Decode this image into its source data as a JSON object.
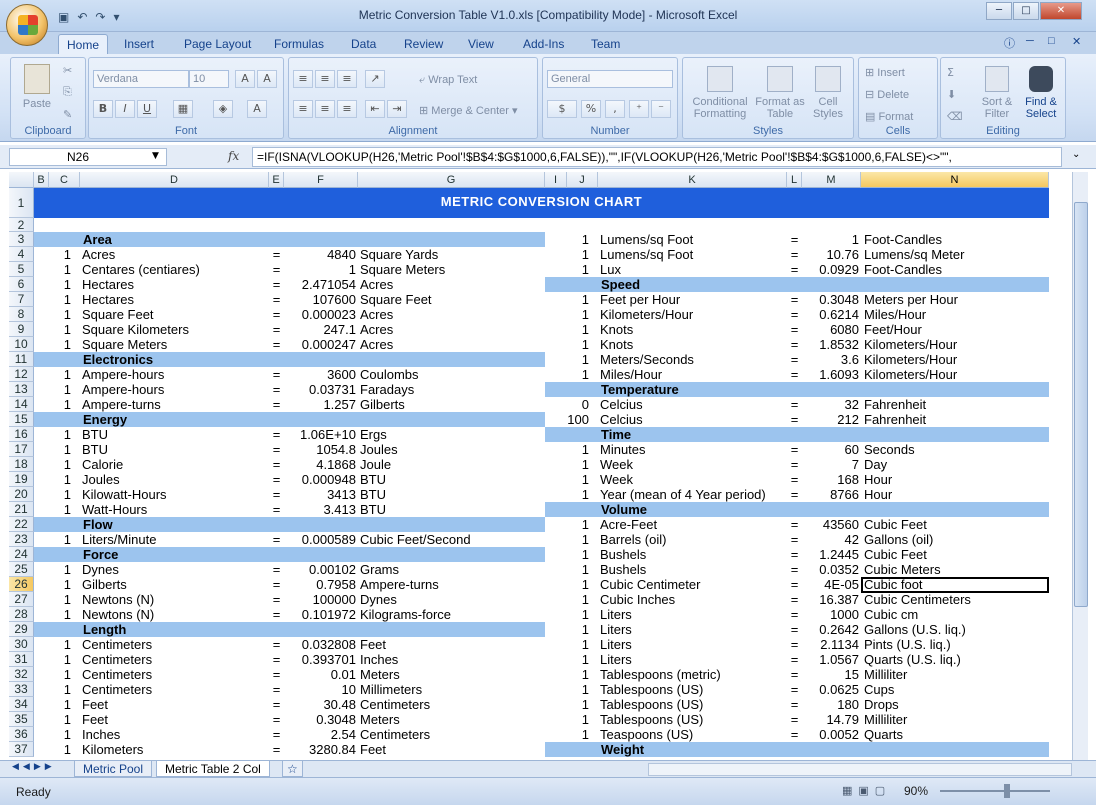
{
  "window": {
    "title": "Metric Conversion Table V1.0.xls  [Compatibility Mode] - Microsoft Excel"
  },
  "tabs": [
    "Home",
    "Insert",
    "Page Layout",
    "Formulas",
    "Data",
    "Review",
    "View",
    "Add-Ins",
    "Team"
  ],
  "ribbon": {
    "clipboard": {
      "paste": "Paste",
      "label": "Clipboard"
    },
    "font": {
      "name": "Verdana",
      "size": "10",
      "label": "Font",
      "bold": "B",
      "italic": "I",
      "underline": "U"
    },
    "alignment": {
      "wrap": "Wrap Text",
      "merge": "Merge & Center",
      "label": "Alignment"
    },
    "number": {
      "format": "General",
      "label": "Number",
      "currency": "$",
      "percent": "%",
      "comma": ","
    },
    "styles": {
      "conditional": "Conditional Formatting",
      "format_table": "Format as Table",
      "cell_styles": "Cell Styles",
      "label": "Styles"
    },
    "cells": {
      "insert": "Insert",
      "delete": "Delete",
      "format": "Format",
      "label": "Cells"
    },
    "editing": {
      "sort": "Sort & Filter",
      "find": "Find & Select",
      "label": "Editing"
    }
  },
  "formula_bar": {
    "name_box": "N26",
    "fx": "fx",
    "formula": "=IF(ISNA(VLOOKUP(H26,'Metric Pool'!$B$4:$G$1000,6,FALSE)),\"\",IF(VLOOKUP(H26,'Metric Pool'!$B$4:$G$1000,6,FALSE)<>\"\","
  },
  "columns_left": [
    "B",
    "C",
    "D",
    "E",
    "F",
    "G"
  ],
  "columns_right": [
    "I",
    "J",
    "K",
    "L",
    "M",
    "N"
  ],
  "rows": [
    "1",
    "2",
    "3",
    "4",
    "5",
    "6",
    "7",
    "8",
    "9",
    "10",
    "11",
    "12",
    "13",
    "14",
    "15",
    "16",
    "17",
    "18",
    "19",
    "20",
    "21",
    "22",
    "23",
    "24",
    "25",
    "26",
    "27",
    "28",
    "29",
    "30",
    "31",
    "32",
    "33",
    "34",
    "35",
    "36",
    "37"
  ],
  "sheet_title": "METRIC CONVERSION CHART",
  "left": [
    {
      "cat": "Area"
    },
    {
      "q": "1",
      "u": "Acres",
      "eq": "=",
      "v": "4840",
      "t": "Square Yards"
    },
    {
      "q": "1",
      "u": "Centares (centiares)",
      "eq": "=",
      "v": "1",
      "t": "Square Meters"
    },
    {
      "q": "1",
      "u": "Hectares",
      "eq": "=",
      "v": "2.471054",
      "t": "Acres"
    },
    {
      "q": "1",
      "u": "Hectares",
      "eq": "=",
      "v": "107600",
      "t": "Square Feet"
    },
    {
      "q": "1",
      "u": "Square Feet",
      "eq": "=",
      "v": "0.000023",
      "t": "Acres"
    },
    {
      "q": "1",
      "u": "Square Kilometers",
      "eq": "=",
      "v": "247.1",
      "t": "Acres"
    },
    {
      "q": "1",
      "u": "Square Meters",
      "eq": "=",
      "v": "0.000247",
      "t": "Acres"
    },
    {
      "cat": "Electronics"
    },
    {
      "q": "1",
      "u": "Ampere-hours",
      "eq": "=",
      "v": "3600",
      "t": "Coulombs"
    },
    {
      "q": "1",
      "u": "Ampere-hours",
      "eq": "=",
      "v": "0.03731",
      "t": "Faradays"
    },
    {
      "q": "1",
      "u": "Ampere-turns",
      "eq": "=",
      "v": "1.257",
      "t": "Gilberts"
    },
    {
      "cat": "Energy"
    },
    {
      "q": "1",
      "u": "BTU",
      "eq": "=",
      "v": "1.06E+10",
      "t": "Ergs"
    },
    {
      "q": "1",
      "u": "BTU",
      "eq": "=",
      "v": "1054.8",
      "t": "Joules"
    },
    {
      "q": "1",
      "u": "Calorie",
      "eq": "=",
      "v": "4.1868",
      "t": "Joule"
    },
    {
      "q": "1",
      "u": "Joules",
      "eq": "=",
      "v": "0.000948",
      "t": "BTU"
    },
    {
      "q": "1",
      "u": "Kilowatt-Hours",
      "eq": "=",
      "v": "3413",
      "t": "BTU"
    },
    {
      "q": "1",
      "u": "Watt-Hours",
      "eq": "=",
      "v": "3.413",
      "t": "BTU"
    },
    {
      "cat": "Flow"
    },
    {
      "q": "1",
      "u": "Liters/Minute",
      "eq": "=",
      "v": "0.000589",
      "t": "Cubic Feet/Second"
    },
    {
      "cat": "Force"
    },
    {
      "q": "1",
      "u": "Dynes",
      "eq": "=",
      "v": "0.00102",
      "t": "Grams"
    },
    {
      "q": "1",
      "u": "Gilberts",
      "eq": "=",
      "v": "0.7958",
      "t": "Ampere-turns"
    },
    {
      "q": "1",
      "u": "Newtons (N)",
      "eq": "=",
      "v": "100000",
      "t": "Dynes"
    },
    {
      "q": "1",
      "u": "Newtons (N)",
      "eq": "=",
      "v": "0.101972",
      "t": "Kilograms-force"
    },
    {
      "cat": "Length"
    },
    {
      "q": "1",
      "u": "Centimeters",
      "eq": "=",
      "v": "0.032808",
      "t": "Feet"
    },
    {
      "q": "1",
      "u": "Centimeters",
      "eq": "=",
      "v": "0.393701",
      "t": "Inches"
    },
    {
      "q": "1",
      "u": "Centimeters",
      "eq": "=",
      "v": "0.01",
      "t": "Meters"
    },
    {
      "q": "1",
      "u": "Centimeters",
      "eq": "=",
      "v": "10",
      "t": "Millimeters"
    },
    {
      "q": "1",
      "u": "Feet",
      "eq": "=",
      "v": "30.48",
      "t": "Centimeters"
    },
    {
      "q": "1",
      "u": "Feet",
      "eq": "=",
      "v": "0.3048",
      "t": "Meters"
    },
    {
      "q": "1",
      "u": "Inches",
      "eq": "=",
      "v": "2.54",
      "t": "Centimeters"
    },
    {
      "q": "1",
      "u": "Kilometers",
      "eq": "=",
      "v": "3280.84",
      "t": "Feet"
    }
  ],
  "right": [
    {
      "q": "1",
      "u": "Lumens/sq Foot",
      "eq": "=",
      "v": "1",
      "t": "Foot-Candles"
    },
    {
      "q": "1",
      "u": "Lumens/sq Foot",
      "eq": "=",
      "v": "10.76",
      "t": "Lumens/sq Meter"
    },
    {
      "q": "1",
      "u": "Lux",
      "eq": "=",
      "v": "0.0929",
      "t": "Foot-Candles"
    },
    {
      "cat": "Speed"
    },
    {
      "q": "1",
      "u": "Feet per Hour",
      "eq": "=",
      "v": "0.3048",
      "t": "Meters per Hour"
    },
    {
      "q": "1",
      "u": "Kilometers/Hour",
      "eq": "=",
      "v": "0.6214",
      "t": "Miles/Hour"
    },
    {
      "q": "1",
      "u": "Knots",
      "eq": "=",
      "v": "6080",
      "t": "Feet/Hour"
    },
    {
      "q": "1",
      "u": "Knots",
      "eq": "=",
      "v": "1.8532",
      "t": "Kilometers/Hour"
    },
    {
      "q": "1",
      "u": "Meters/Seconds",
      "eq": "=",
      "v": "3.6",
      "t": "Kilometers/Hour"
    },
    {
      "q": "1",
      "u": "Miles/Hour",
      "eq": "=",
      "v": "1.6093",
      "t": "Kilometers/Hour"
    },
    {
      "cat": "Temperature"
    },
    {
      "q": "0",
      "u": "Celcius",
      "eq": "=",
      "v": "32",
      "t": "Fahrenheit"
    },
    {
      "q": "100",
      "u": "Celcius",
      "eq": "=",
      "v": "212",
      "t": "Fahrenheit"
    },
    {
      "cat": "Time"
    },
    {
      "q": "1",
      "u": "Minutes",
      "eq": "=",
      "v": "60",
      "t": "Seconds"
    },
    {
      "q": "1",
      "u": "Week",
      "eq": "=",
      "v": "7",
      "t": "Day"
    },
    {
      "q": "1",
      "u": "Week",
      "eq": "=",
      "v": "168",
      "t": "Hour"
    },
    {
      "q": "1",
      "u": "Year (mean of 4 Year period)",
      "eq": "=",
      "v": "8766",
      "t": "Hour"
    },
    {
      "cat": "Volume"
    },
    {
      "q": "1",
      "u": "Acre-Feet",
      "eq": "=",
      "v": "43560",
      "t": "Cubic Feet"
    },
    {
      "q": "1",
      "u": "Barrels (oil)",
      "eq": "=",
      "v": "42",
      "t": "Gallons (oil)"
    },
    {
      "q": "1",
      "u": "Bushels",
      "eq": "=",
      "v": "1.2445",
      "t": "Cubic Feet"
    },
    {
      "q": "1",
      "u": "Bushels",
      "eq": "=",
      "v": "0.0352",
      "t": "Cubic Meters"
    },
    {
      "q": "1",
      "u": "Cubic Centimeter",
      "eq": "=",
      "v": "4E-05",
      "t": "Cubic foot"
    },
    {
      "q": "1",
      "u": "Cubic Inches",
      "eq": "=",
      "v": "16.387",
      "t": "Cubic Centimeters"
    },
    {
      "q": "1",
      "u": "Liters",
      "eq": "=",
      "v": "1000",
      "t": "Cubic cm"
    },
    {
      "q": "1",
      "u": "Liters",
      "eq": "=",
      "v": "0.2642",
      "t": "Gallons (U.S. liq.)"
    },
    {
      "q": "1",
      "u": "Liters",
      "eq": "=",
      "v": "2.1134",
      "t": "Pints (U.S. liq.)"
    },
    {
      "q": "1",
      "u": "Liters",
      "eq": "=",
      "v": "1.0567",
      "t": "Quarts (U.S. liq.)"
    },
    {
      "q": "1",
      "u": "Tablespoons (metric)",
      "eq": "=",
      "v": "15",
      "t": "Milliliter"
    },
    {
      "q": "1",
      "u": "Tablespoons (US)",
      "eq": "=",
      "v": "0.0625",
      "t": "Cups"
    },
    {
      "q": "1",
      "u": "Tablespoons (US)",
      "eq": "=",
      "v": "180",
      "t": "Drops"
    },
    {
      "q": "1",
      "u": "Tablespoons (US)",
      "eq": "=",
      "v": "14.79",
      "t": "Milliliter"
    },
    {
      "q": "1",
      "u": "Teaspoons (US)",
      "eq": "=",
      "v": "0.0052",
      "t": "Quarts"
    },
    {
      "cat": "Weight"
    }
  ],
  "sheets": [
    "Metric Pool",
    "Metric Table 2 Col"
  ],
  "status": {
    "text": "Ready",
    "zoom": "90%"
  },
  "colors": {
    "band": "#9cc4ee",
    "title_bg": "#1f5fdc"
  }
}
